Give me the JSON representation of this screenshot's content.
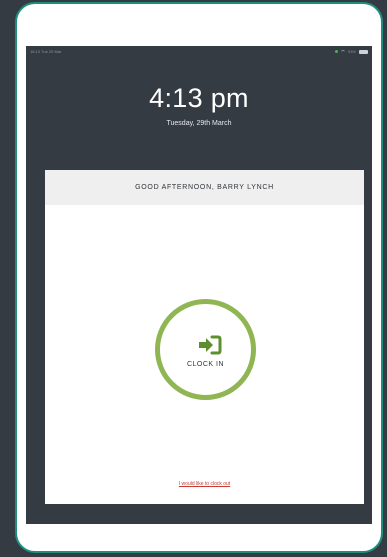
{
  "status_bar": {
    "left_text": "16:13  Tue 29 Mar",
    "battery_text": "93%"
  },
  "clock": {
    "time": "4:13 pm",
    "date": "Tuesday, 29th March"
  },
  "card": {
    "greeting": "GOOD AFTERNOON, BARRY LYNCH",
    "clock_in_label": "CLOCK IN",
    "clock_out_link": "I would like to clock out"
  },
  "icons": {
    "clock_in_icon": "sign-in-arrow-icon",
    "wifi_icon": "wifi-icon",
    "battery_icon": "battery-icon"
  },
  "colors": {
    "background": "#353b43",
    "frame_accent": "#1f8e7f",
    "clock_in_ring": "#8fb653",
    "clock_in_icon": "#5d8f2f",
    "link_red": "#c83b35",
    "header_bg": "#efefef"
  }
}
